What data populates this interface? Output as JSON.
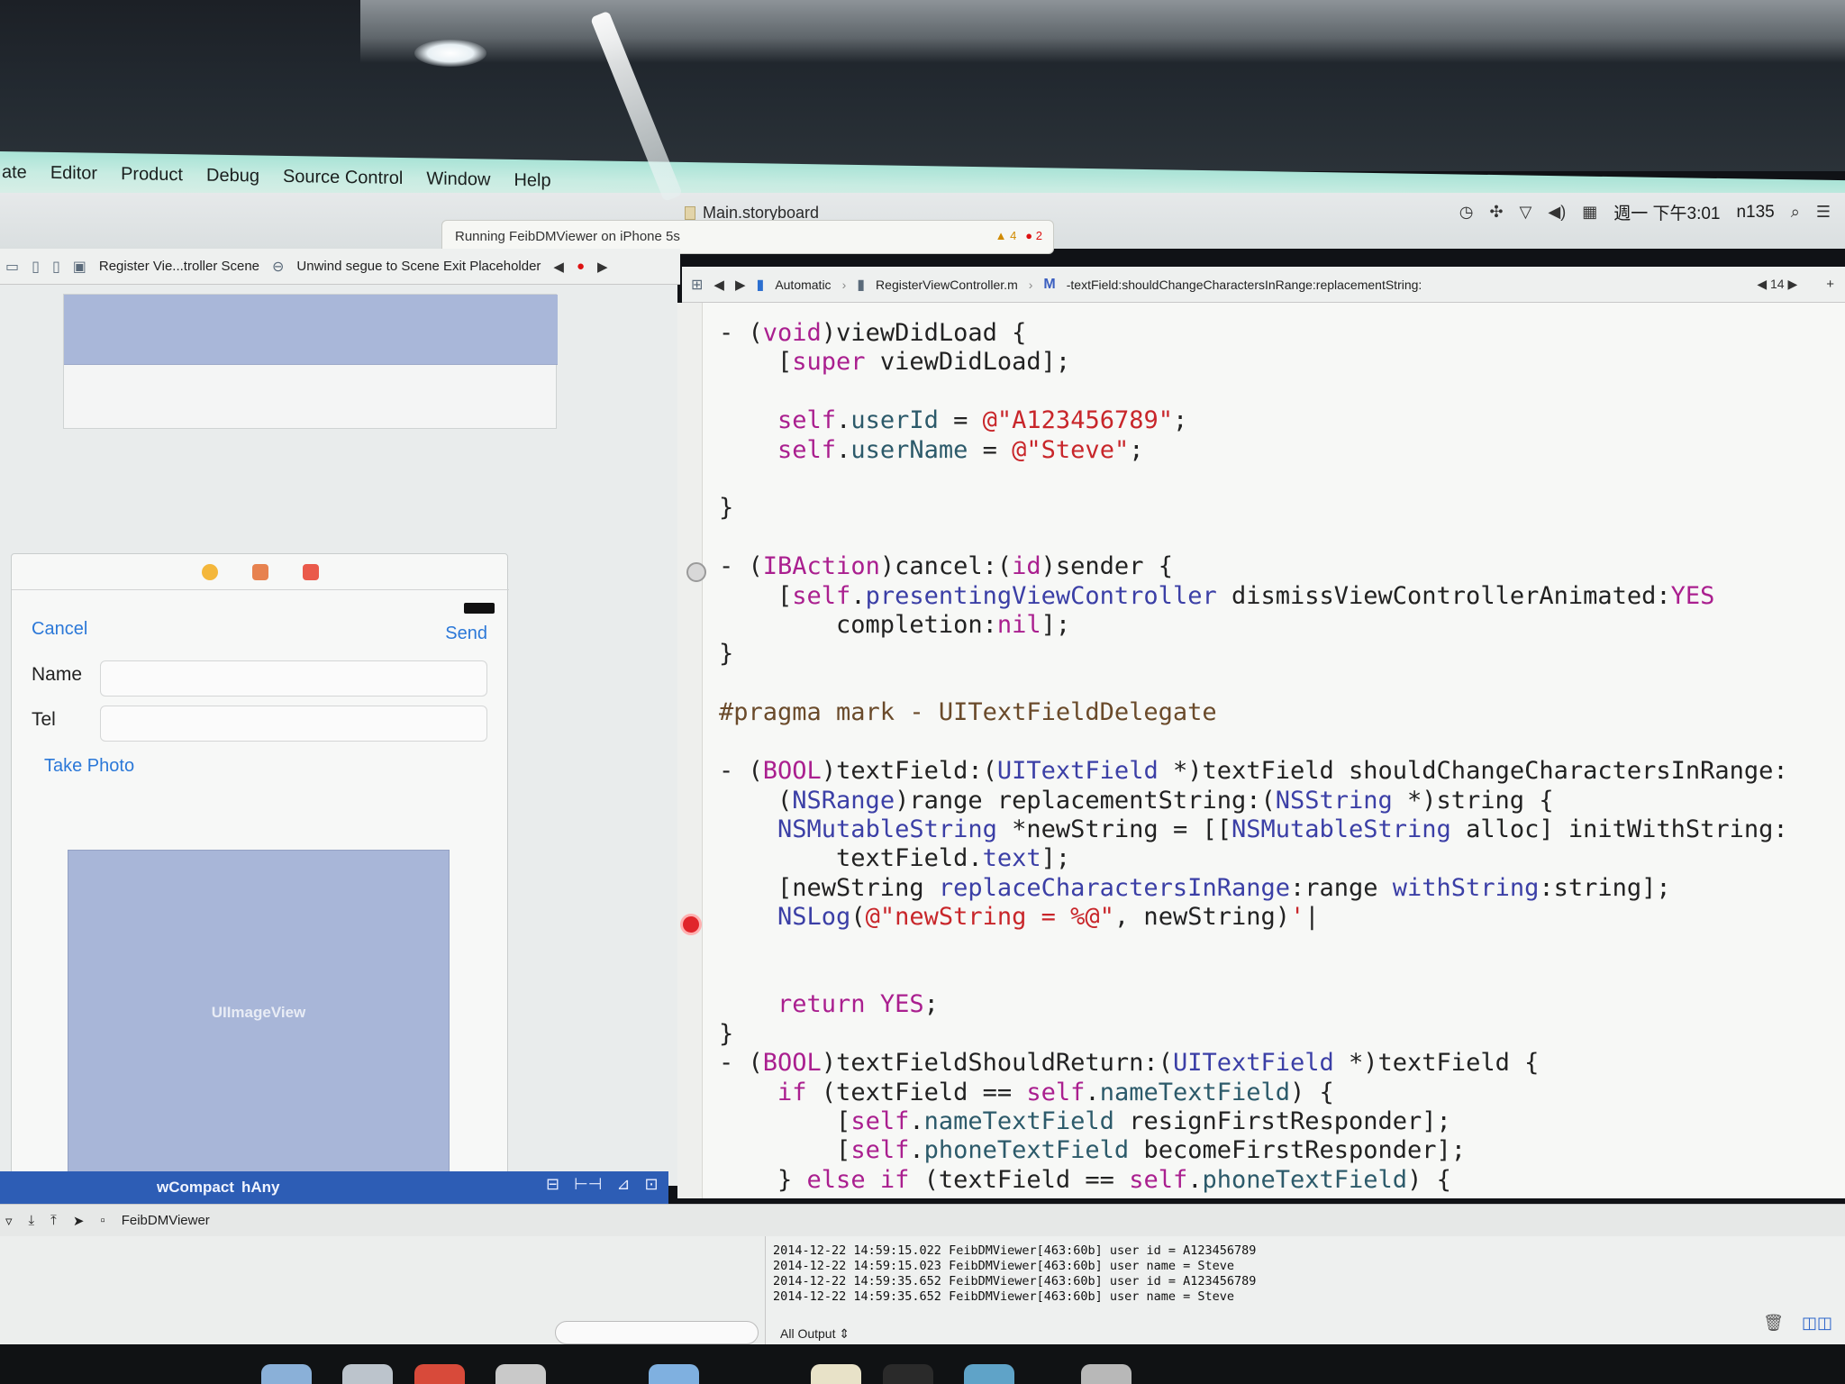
{
  "menubar": {
    "items": [
      "ate",
      "Editor",
      "Product",
      "Debug",
      "Source Control",
      "Window",
      "Help"
    ],
    "clock": "週一 下午3:01",
    "user": "n135"
  },
  "window": {
    "title": "Main.storyboard",
    "activity": "Running FeibDMViewer on iPhone 5s",
    "warnings": "4",
    "errors": "2"
  },
  "jumpbar_left": {
    "scene": "Register Vie...troller Scene",
    "segue": "Unwind segue to Scene Exit Placeholder"
  },
  "jumpbar_right": {
    "mode": "Automatic",
    "file": "RegisterViewController.m",
    "method": "-textField:shouldChangeCharactersInRange:replacementString:",
    "counter": "14"
  },
  "storyboard": {
    "cancel": "Cancel",
    "send": "Send",
    "name_label": "Name",
    "tel_label": "Tel",
    "take_photo": "Take Photo",
    "image_view": "UIImageView",
    "size_class_w": "wCompact",
    "size_class_h": "hAny"
  },
  "debug": {
    "target": "FeibDMViewer",
    "console_lines": [
      "2014-12-22 14:59:15.022 FeibDMViewer[463:60b] user id = A123456789",
      "2014-12-22 14:59:15.023 FeibDMViewer[463:60b] user name = Steve",
      "2014-12-22 14:59:35.652 FeibDMViewer[463:60b] user id = A123456789",
      "2014-12-22 14:59:35.652 FeibDMViewer[463:60b] user name = Steve"
    ],
    "output_select": "All Output"
  },
  "colors": {
    "menubar": "#c8ece2",
    "accent_blue": "#2b78d8",
    "size_class_bar": "#2d5db5",
    "breakpoint": "#e0252b"
  }
}
